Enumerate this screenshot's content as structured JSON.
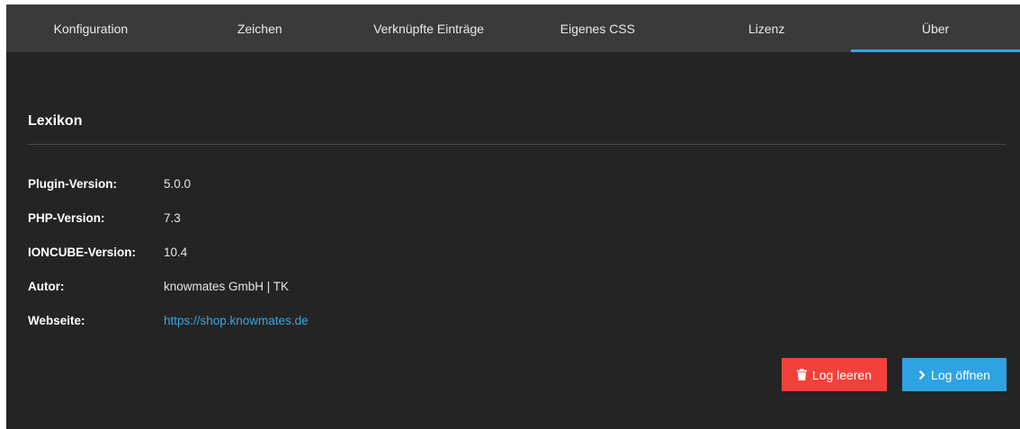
{
  "tabs": [
    {
      "label": "Konfiguration",
      "active": false
    },
    {
      "label": "Zeichen",
      "active": false
    },
    {
      "label": "Verknüpfte Einträge",
      "active": false
    },
    {
      "label": "Eigenes CSS",
      "active": false
    },
    {
      "label": "Lizenz",
      "active": false
    },
    {
      "label": "Über",
      "active": true
    }
  ],
  "section": {
    "title": "Lexikon"
  },
  "info": {
    "plugin_version_label": "Plugin-Version:",
    "plugin_version_value": "5.0.0",
    "php_version_label": "PHP-Version:",
    "php_version_value": "7.3",
    "ioncube_version_label": "IONCUBE-Version:",
    "ioncube_version_value": "10.4",
    "author_label": "Autor:",
    "author_value": "knowmates GmbH | TK",
    "website_label": "Webseite:",
    "website_value": "https://shop.knowmates.de"
  },
  "actions": {
    "clear_log_label": "Log leeren",
    "clear_log_icon": "trash-icon",
    "open_log_label": "Log öffnen",
    "open_log_icon": "chevron-right-icon"
  },
  "colors": {
    "accent_blue": "#2ea3e3",
    "danger_red": "#f2413b",
    "tab_bar": "#3a3a3a",
    "panel": "#242424"
  }
}
